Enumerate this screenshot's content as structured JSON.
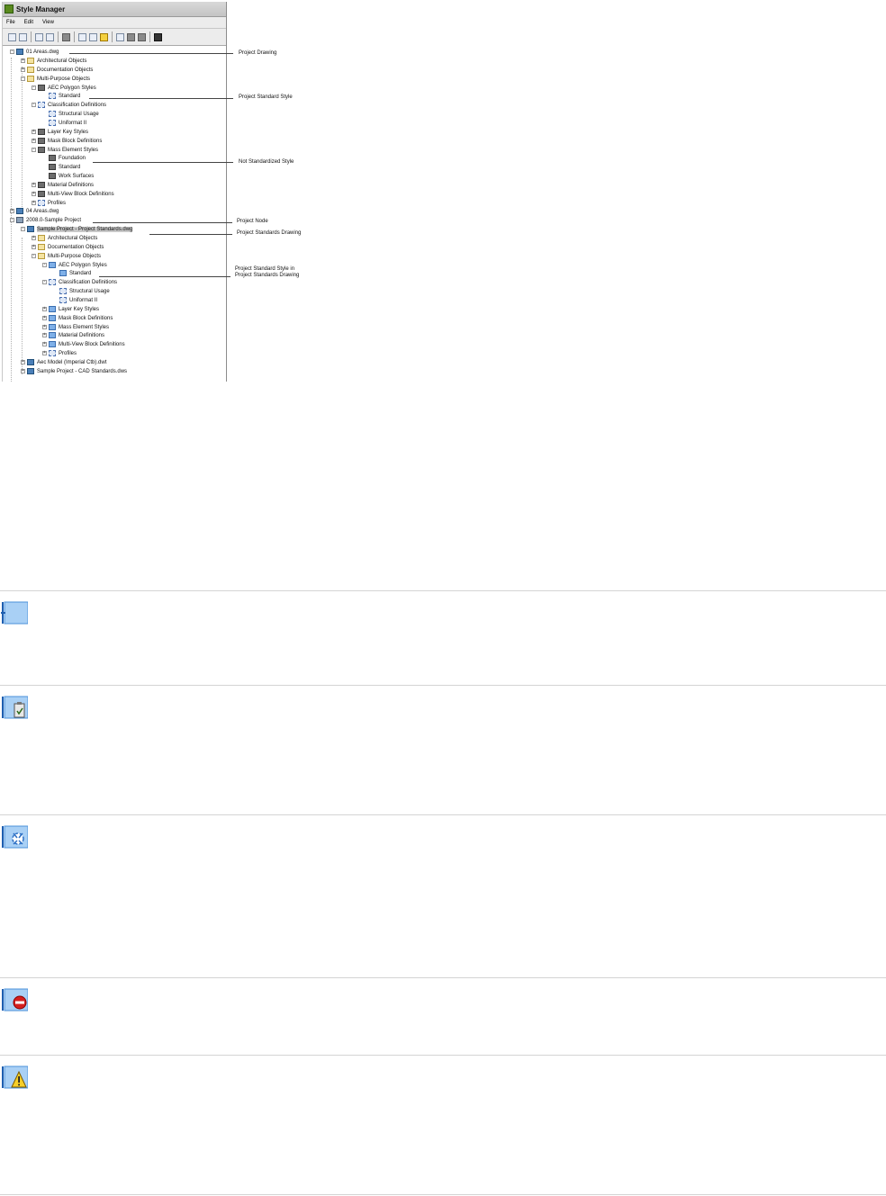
{
  "window": {
    "title": "Style Manager",
    "menu": [
      "File",
      "Edit",
      "View"
    ]
  },
  "tree": [
    {
      "label": "01 Areas.dwg",
      "icon": "drawing-icon"
    },
    {
      "label": "Architectural Objects",
      "icon": "folder-icon"
    },
    {
      "label": "Documentation Objects",
      "icon": "folder-icon"
    },
    {
      "label": "Multi-Purpose Objects",
      "icon": "folder-icon"
    },
    {
      "label": "AEC Polygon Styles",
      "icon": "style-icon"
    },
    {
      "label": "Standard",
      "icon": "classification-icon"
    },
    {
      "label": "Classification Definitions",
      "icon": "classification-icon"
    },
    {
      "label": "Structural Usage",
      "icon": "classification-icon"
    },
    {
      "label": "Uniformat II",
      "icon": "classification-icon"
    },
    {
      "label": "Layer Key Styles",
      "icon": "style-icon"
    },
    {
      "label": "Mask Block Definitions",
      "icon": "style-icon"
    },
    {
      "label": "Mass Element Styles",
      "icon": "style-icon"
    },
    {
      "label": "Foundation",
      "icon": "style-icon"
    },
    {
      "label": "Standard",
      "icon": "style-icon"
    },
    {
      "label": "Work Surfaces",
      "icon": "style-icon"
    },
    {
      "label": "Material Definitions",
      "icon": "style-icon"
    },
    {
      "label": "Multi-View Block Definitions",
      "icon": "style-icon"
    },
    {
      "label": "Profiles",
      "icon": "profile-icon"
    },
    {
      "label": "04 Areas.dwg",
      "icon": "drawing-icon"
    },
    {
      "label": "2008.0-Sample Project",
      "icon": "project-icon"
    },
    {
      "label": "Sample Project - Project Standards.dwg",
      "icon": "drawing-icon"
    },
    {
      "label": "Architectural Objects",
      "icon": "folder-icon"
    },
    {
      "label": "Documentation Objects",
      "icon": "folder-icon"
    },
    {
      "label": "Multi-Purpose Objects",
      "icon": "folder-icon"
    },
    {
      "label": "AEC Polygon Styles",
      "icon": "style-icon"
    },
    {
      "label": "Standard",
      "icon": "style-icon"
    },
    {
      "label": "Classification Definitions",
      "icon": "classification-icon"
    },
    {
      "label": "Structural Usage",
      "icon": "classification-icon"
    },
    {
      "label": "Uniformat II",
      "icon": "classification-icon"
    },
    {
      "label": "Layer Key Styles",
      "icon": "style-icon"
    },
    {
      "label": "Mask Block Definitions",
      "icon": "style-icon"
    },
    {
      "label": "Mass Element Styles",
      "icon": "style-icon"
    },
    {
      "label": "Material Definitions",
      "icon": "style-icon"
    },
    {
      "label": "Multi-View Block Definitions",
      "icon": "style-icon"
    },
    {
      "label": "Profiles",
      "icon": "profile-icon"
    },
    {
      "label": "Aec Model (Imperial Ctb).dwt",
      "icon": "drawing-icon"
    },
    {
      "label": "Sample Project - CAD Standards.dws",
      "icon": "drawing-icon"
    }
  ],
  "callouts": {
    "project_drawing": "Project Drawing",
    "project_standard_style": "Project Standard Style",
    "not_standardized_style": "Not Standardized Style",
    "project_node": "Project Node",
    "project_standards_drawing": "Project Standards Drawing",
    "project_standard_style_in_1": "Project Standard Style in",
    "project_standard_style_in_2": "Project Standards Drawing"
  },
  "icon_rows": [
    {
      "icon": "blue-book-icon"
    },
    {
      "icon": "book-clipboard-icon"
    },
    {
      "icon": "book-sync-icon"
    },
    {
      "icon": "book-no-entry-icon"
    },
    {
      "icon": "book-warning-icon"
    }
  ],
  "colors": {
    "selection": "#c8c8c8",
    "accent_blue": "#4a90d9"
  }
}
